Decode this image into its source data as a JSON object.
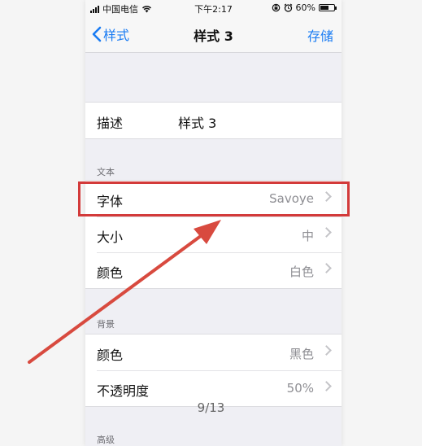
{
  "status_bar": {
    "carrier": "中国电信",
    "time": "下午2:17",
    "battery_text": "60%",
    "battery_level": 0.6
  },
  "nav": {
    "back_label": "样式",
    "title": "样式 3",
    "save_label": "存储"
  },
  "description": {
    "label": "描述",
    "value": "样式 3"
  },
  "sections": {
    "text": {
      "header": "文本",
      "rows": [
        {
          "label": "字体",
          "value": "Savoye"
        },
        {
          "label": "大小",
          "value": "中"
        },
        {
          "label": "颜色",
          "value": "白色"
        }
      ]
    },
    "background": {
      "header": "背景",
      "rows": [
        {
          "label": "颜色",
          "value": "黑色"
        },
        {
          "label": "不透明度",
          "value": "50%"
        }
      ]
    },
    "advanced": {
      "header": "高级"
    }
  },
  "overlay": {
    "page_indicator": "9/13",
    "highlight_color": "#d33a3a",
    "accent_color": "#1a7cf3"
  },
  "icons": [
    "signal-icon",
    "wifi-icon",
    "lock-rotation-icon",
    "alarm-icon",
    "battery-icon",
    "chevron-left-icon",
    "chevron-right-icon",
    "annotation-arrow"
  ]
}
